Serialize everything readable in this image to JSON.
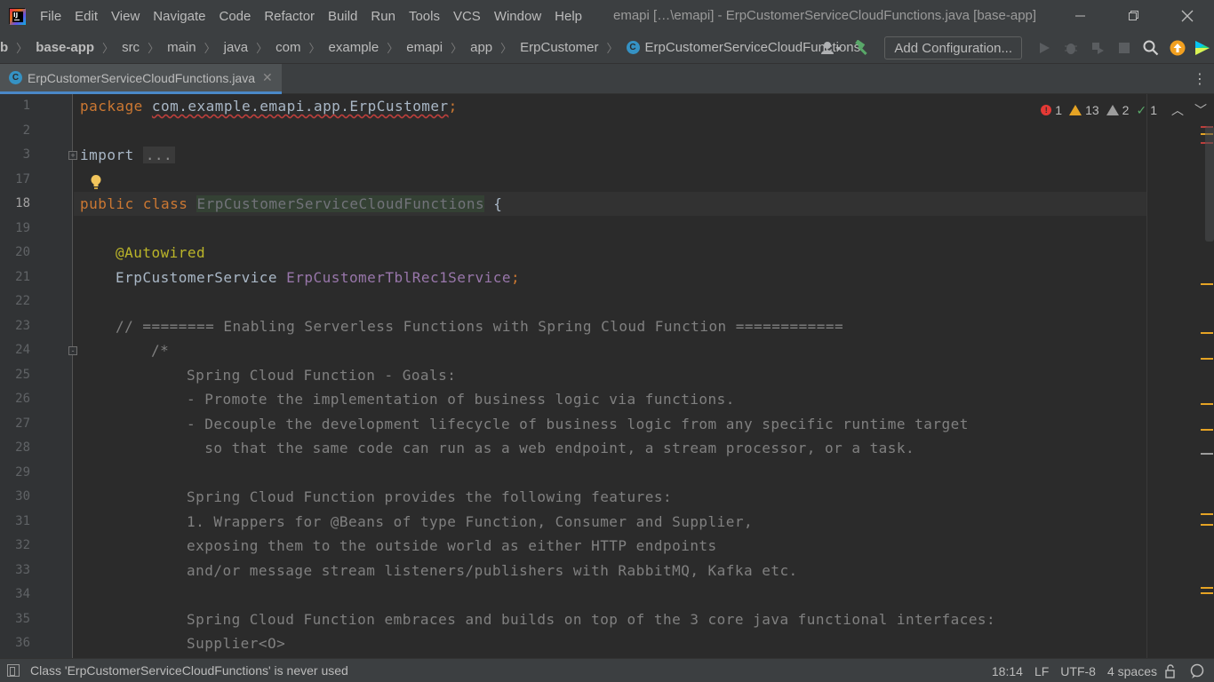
{
  "menubar": {
    "items": [
      "File",
      "Edit",
      "View",
      "Navigate",
      "Code",
      "Refactor",
      "Build",
      "Run",
      "Tools",
      "VCS",
      "Window",
      "Help"
    ],
    "mnemonics": [
      "F",
      "E",
      "V",
      "N",
      "C",
      "R",
      "B",
      "R",
      "T",
      "S",
      "W",
      "H"
    ],
    "window_title": "emapi […\\emapi] - ErpCustomerServiceCloudFunctions.java [base-app]"
  },
  "navbar": {
    "crumbs": [
      "b",
      "base-app",
      "src",
      "main",
      "java",
      "com",
      "example",
      "emapi",
      "app",
      "ErpCustomer",
      "ErpCustomerServiceCloudFunctions"
    ],
    "add_configuration": "Add Configuration..."
  },
  "tab": {
    "label": "ErpCustomerServiceCloudFunctions.java"
  },
  "inspections": {
    "errors": "1",
    "warnings": "13",
    "weak_warnings": "2",
    "ok": "1"
  },
  "editor": {
    "line_numbers": [
      "1",
      "2",
      "3",
      "17",
      "18",
      "19",
      "20",
      "21",
      "22",
      "23",
      "24",
      "25",
      "26",
      "27",
      "28",
      "29",
      "30",
      "31",
      "32",
      "33",
      "34",
      "35",
      "36"
    ],
    "current_line": "18",
    "code": {
      "package_kw": "package",
      "package_name": "com.example.emapi.app.ErpCustomer",
      "semicolon": ";",
      "import_kw": "import",
      "import_folded": "...",
      "public_class_kw": "public class",
      "class_name": "ErpCustomerServiceCloudFunctions",
      "open_brace": "{",
      "annotation": "@Autowired",
      "field_type": "ErpCustomerService",
      "field_name": "ErpCustomerTblRec1Service",
      "comment_header": "// ======== Enabling Serverless Functions with Spring Cloud Function ============",
      "comment_open": "/*",
      "c25": "Spring Cloud Function - Goals:",
      "c26": "- Promote the implementation of business logic via functions.",
      "c27": "- Decouple the development lifecycle of business logic from any specific runtime target",
      "c28": "  so that the same code can run as a web endpoint, a stream processor, or a task.",
      "c30": "Spring Cloud Function provides the following features:",
      "c31": "1. Wrappers for @Beans of type Function, Consumer and Supplier,",
      "c32": "exposing them to the outside world as either HTTP endpoints",
      "c33": "and/or message stream listeners/publishers with RabbitMQ, Kafka etc.",
      "c35": "Spring Cloud Function embraces and builds on top of the 3 core java functional interfaces:",
      "c36": "Supplier<O>"
    }
  },
  "statusbar": {
    "message": "Class 'ErpCustomerServiceCloudFunctions' is never used",
    "position": "18:14",
    "line_separator": "LF",
    "encoding": "UTF-8",
    "indent": "4 spaces"
  },
  "colors": {
    "background": "#2b2b2b",
    "panel": "#3c3f41",
    "keyword": "#cc7832",
    "annotation": "#bbb529",
    "field": "#9876aa",
    "comment": "#808080",
    "error": "#e53935",
    "warning": "#e5a324"
  },
  "icons": [
    "app-logo-icon",
    "minimize-icon",
    "maximize-icon",
    "close-icon",
    "class-icon",
    "user-icon",
    "build-hammer-icon",
    "run-icon",
    "debug-icon",
    "coverage-icon",
    "stop-icon",
    "search-icon",
    "update-icon",
    "toolbox-icon",
    "tab-menu-icon",
    "lightbulb-icon",
    "fold-icon",
    "error-icon",
    "warning-icon",
    "weak-warning-icon",
    "check-icon",
    "chevron-up-icon",
    "chevron-down-icon",
    "tool-window-toggle-icon",
    "lock-icon",
    "event-log-icon"
  ]
}
